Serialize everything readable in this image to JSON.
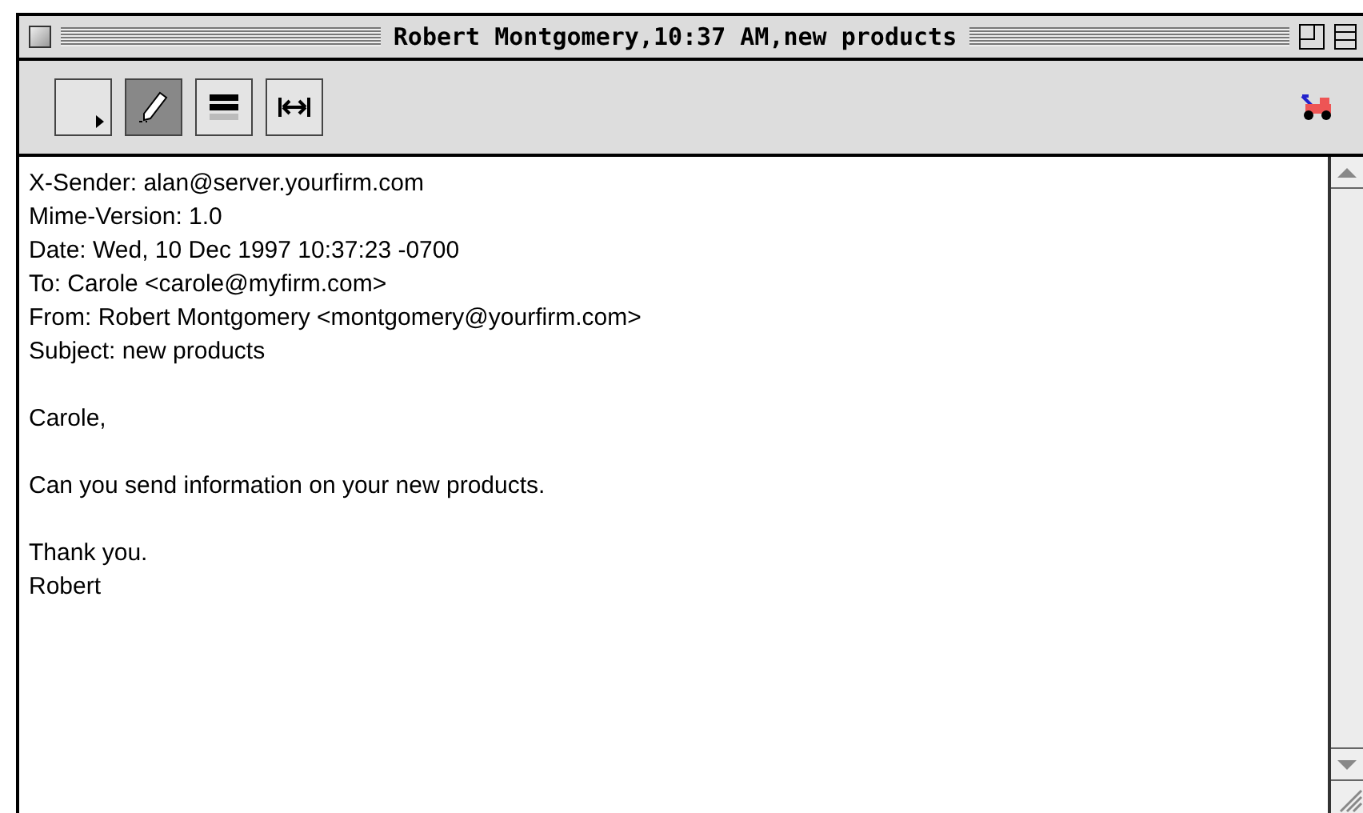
{
  "window": {
    "title": "Robert Montgomery,10:37 AM,new products"
  },
  "toolbar": {
    "buttons": [
      {
        "kind": "menu",
        "selected": false
      },
      {
        "kind": "pencil",
        "selected": true
      },
      {
        "kind": "blah",
        "selected": false
      },
      {
        "kind": "width",
        "selected": false
      }
    ]
  },
  "message": {
    "paragraphs": [
      [
        "X-Sender: alan@server.yourfirm.com",
        "Mime-Version: 1.0",
        "Date: Wed, 10 Dec 1997 10:37:23 -0700",
        "To: Carole <carole@myfirm.com>",
        "From: Robert Montgomery <montgomery@yourfirm.com>",
        "Subject: new products"
      ],
      [
        "Carole,"
      ],
      [
        "Can you send information on your new products."
      ],
      [
        "Thank you.",
        "Robert"
      ]
    ]
  }
}
